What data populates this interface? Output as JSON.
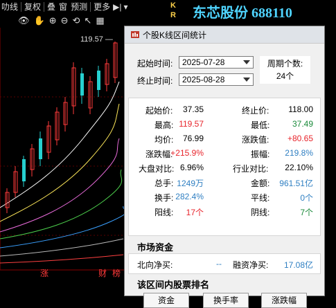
{
  "toolbar": {
    "items": [
      "叻线",
      "复权",
      "叠",
      "窗",
      "预测",
      "更多"
    ]
  },
  "header": {
    "kr_badge": "K R",
    "stock_title": "东芯股份 688110"
  },
  "chart": {
    "peak_label": "119.57 —",
    "bottom_labels": [
      "涨",
      "财",
      "榜"
    ]
  },
  "dialog": {
    "title": "个股K线区间统计",
    "start_label": "起始时间:",
    "start_value": "2025-07-28",
    "end_label": "终止时间:",
    "end_value": "2025-08-28",
    "period_label": "周期个数:",
    "period_value": "24个",
    "stats": [
      {
        "label": "起始价:",
        "value": "37.35",
        "label2": "终止价:",
        "value2": "118.00"
      },
      {
        "label": "最高:",
        "value": "119.57",
        "label2": "最低:",
        "value2": "37.49"
      },
      {
        "label": "均价:",
        "value": "76.99",
        "label2": "涨跌值:",
        "value2": "+80.65"
      },
      {
        "label": "涨跌幅:",
        "value": "+215.9%",
        "label2": "振幅:",
        "value2": "219.8%"
      },
      {
        "label": "大盘对比:",
        "value": "6.96%",
        "label2": "行业对比:",
        "value2": "22.10%"
      },
      {
        "label": "总手:",
        "value": "1249万",
        "label2": "金额:",
        "value2": "961.51亿"
      },
      {
        "label": "换手:",
        "value": "282.4%",
        "label2": "平线:",
        "value2": "0个"
      },
      {
        "label": "阳线:",
        "value": "17个",
        "label2": "阴线:",
        "value2": "7个"
      }
    ],
    "money_flow_title": "市场资金",
    "north_label": "北向净买:",
    "north_value": "--",
    "margin_label": "融资净买:",
    "margin_value": "17.08亿",
    "ranking_title": "该区间内股票排名",
    "buttons": [
      "资金",
      "换手率",
      "涨跌幅"
    ]
  },
  "colors": {
    "up": "#e8242b",
    "down": "#1a8a3a",
    "neutral": "#2f7fc2",
    "title": "#4fd4ff"
  }
}
